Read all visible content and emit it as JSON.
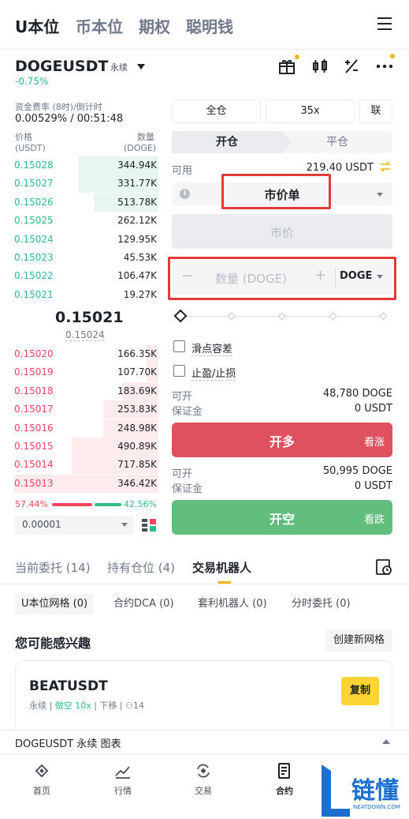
{
  "top_tabs": [
    "U本位",
    "币本位",
    "期权",
    "聪明钱"
  ],
  "symbol": "DOGEUSDT",
  "perp_tag": "永续",
  "change": "-0.75%",
  "funding_label": "资金费率 (8时)/倒计时",
  "funding_value": "0.00529% / 00:51:48",
  "ob_price_label": "价格",
  "ob_price_unit": "(USDT)",
  "ob_qty_label": "数量",
  "ob_qty_unit": "(DOGE)",
  "asks": [
    {
      "price": "0.15028",
      "qty": "344.94K",
      "depth": 0.55
    },
    {
      "price": "0.15027",
      "qty": "331.77K",
      "depth": 0.55
    },
    {
      "price": "0.15026",
      "qty": "513.78K",
      "depth": 0.45
    },
    {
      "price": "0.15025",
      "qty": "262.12K",
      "depth": 0
    },
    {
      "price": "0.15024",
      "qty": "129.95K",
      "depth": 0
    },
    {
      "price": "0.15023",
      "qty": "45.53K",
      "depth": 0
    },
    {
      "price": "0.15022",
      "qty": "106.47K",
      "depth": 0
    },
    {
      "price": "0.15021",
      "qty": "19.27K",
      "depth": 0
    }
  ],
  "last_price": "0.15021",
  "mark_price": "0.15024",
  "bids": [
    {
      "price": "0.15020",
      "qty": "166.35K",
      "depth": 0.08
    },
    {
      "price": "0.15019",
      "qty": "107.70K",
      "depth": 0.08
    },
    {
      "price": "0.15018",
      "qty": "183.69K",
      "depth": 0.25
    },
    {
      "price": "0.15017",
      "qty": "253.83K",
      "depth": 0.38
    },
    {
      "price": "0.15016",
      "qty": "248.98K",
      "depth": 0.38
    },
    {
      "price": "0.15015",
      "qty": "490.89K",
      "depth": 0.6
    },
    {
      "price": "0.15014",
      "qty": "717.85K",
      "depth": 0.6
    },
    {
      "price": "0.15013",
      "qty": "346.42K",
      "depth": 1.0
    }
  ],
  "ratio_buy": "57.44%",
  "ratio_sell": "42.56%",
  "ratio_buy_value": 57.44,
  "precision": "0.00001",
  "margin_mode": "全仓",
  "leverage": "35x",
  "asset_mode": "联",
  "tab_open": "开仓",
  "tab_close": "平仓",
  "available_label": "可用",
  "available_value": "219.40 USDT",
  "order_type": "市价单",
  "price_placeholder": "市价",
  "qty_placeholder": "数量 (DOGE)",
  "qty_unit": "DOGE",
  "slippage_label": "滑点容差",
  "tpsl_label": "止盈/止损",
  "long_max_label": "可开",
  "long_max_value": "48,780 DOGE",
  "long_margin_label": "保证金",
  "long_margin_value": "0 USDT",
  "long_btn": "开多",
  "long_hint": "看涨",
  "short_max_label": "可开",
  "short_max_value": "50,995 DOGE",
  "short_margin_label": "保证金",
  "short_margin_value": "0 USDT",
  "short_btn": "开空",
  "short_hint": "看跌",
  "bottom_tabs": [
    "当前委托 (14)",
    "持有仓位 (4)",
    "交易机器人"
  ],
  "bot_pills": [
    "U本位网格 (0)",
    "合约DCA (0)",
    "套利机器人 (0)",
    "分时委托 (0)"
  ],
  "interest_title": "您可能感兴趣",
  "create_grid": "创建新网格",
  "card_symbol": "BEATUSDT",
  "card_perp": "永续",
  "card_short": "做空 10x",
  "card_dir": "下移",
  "card_people": "14",
  "copy_btn": "复制",
  "chart_bar_label": "DOGEUSDT 永续  图表",
  "nav": [
    "首页",
    "行情",
    "交易",
    "合约",
    "链懂"
  ],
  "watermark_text": "链懂",
  "watermark_sub": "NEATDOWN.COM",
  "colors": {
    "green": "#2ebd85",
    "red": "#f6465d",
    "yellow": "#f0b90b"
  }
}
